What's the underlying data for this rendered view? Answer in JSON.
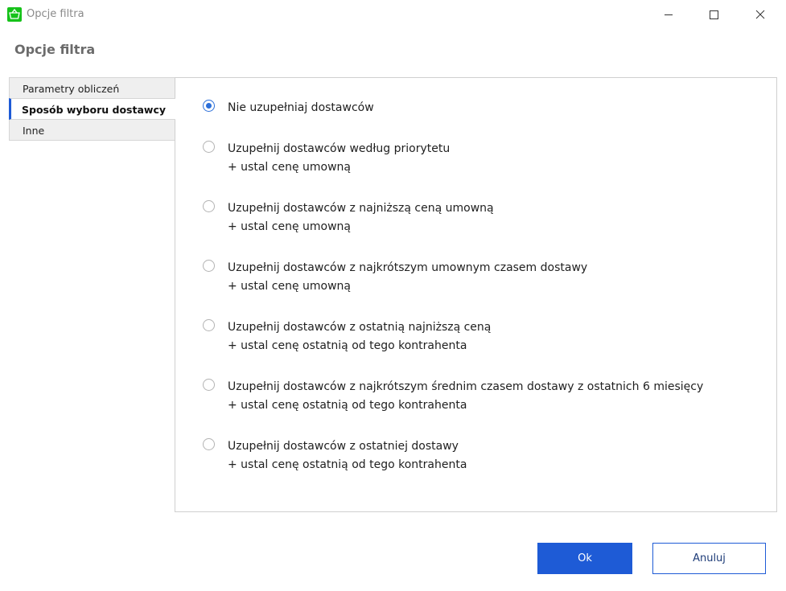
{
  "window": {
    "title": "Opcje filtra",
    "app_icon": "basket-icon",
    "controls": [
      "minimize-icon",
      "maximize-icon",
      "close-icon"
    ]
  },
  "dialog": {
    "title": "Opcje filtra"
  },
  "tabs": [
    {
      "label": "Parametry obliczeń",
      "active": false
    },
    {
      "label": "Sposób wyboru dostawcy",
      "active": true
    },
    {
      "label": "Inne",
      "active": false
    }
  ],
  "options": [
    {
      "line1": "Nie uzupełniaj dostawców",
      "line2": "",
      "selected": true
    },
    {
      "line1": "Uzupełnij dostawców według priorytetu",
      "line2": "+ ustal cenę umowną",
      "selected": false
    },
    {
      "line1": "Uzupełnij dostawców z najniższą ceną umowną",
      "line2": "+ ustal cenę umowną",
      "selected": false
    },
    {
      "line1": "Uzupełnij dostawców z najkrótszym umownym czasem dostawy",
      "line2": "+ ustal cenę umowną",
      "selected": false
    },
    {
      "line1": "Uzupełnij dostawców z ostatnią najniższą ceną",
      "line2": "+ ustal cenę ostatnią od tego kontrahenta",
      "selected": false
    },
    {
      "line1": "Uzupełnij dostawców z najkrótszym średnim czasem dostawy z ostatnich 6 miesięcy",
      "line2": "+ ustal cenę ostatnią od tego kontrahenta",
      "selected": false
    },
    {
      "line1": "Uzupełnij dostawców z ostatniej dostawy",
      "line2": "+ ustal cenę ostatnią od tego kontrahenta",
      "selected": false
    }
  ],
  "buttons": {
    "ok_label": "Ok",
    "cancel_label": "Anuluj"
  },
  "colors": {
    "accent": "#1e5bd6",
    "app_icon": "#16c21a"
  }
}
